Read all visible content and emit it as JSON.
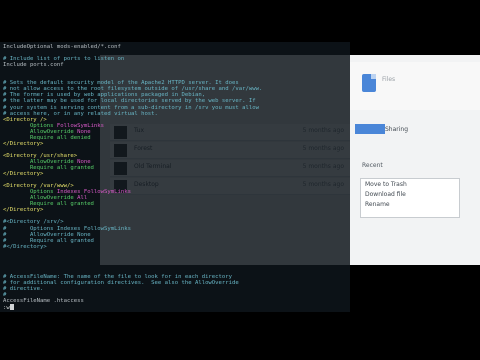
{
  "background_app": {
    "header_label": "Files",
    "rows": [
      {
        "name": "Tux",
        "date": "5 months ago"
      },
      {
        "name": "Forest",
        "date": "5 months ago"
      },
      {
        "name": "Old Terminal",
        "date": "5 months ago"
      },
      {
        "name": "Desktop",
        "date": "5 months ago"
      }
    ],
    "share_button": "",
    "share_link": "Sharing",
    "section_title": "Recent",
    "menu_items": [
      "Move to Trash",
      "Download file",
      "Rename"
    ]
  },
  "terminal": {
    "lines": [
      {
        "parts": [
          {
            "text": "IncludeOptional mods-enabled/*.conf",
            "class": ""
          }
        ]
      },
      {
        "parts": [
          {
            "text": "",
            "class": ""
          }
        ]
      },
      {
        "parts": [
          {
            "text": "# Include list of ports to listen on",
            "class": "c-comment"
          }
        ]
      },
      {
        "parts": [
          {
            "text": "Include ports.conf",
            "class": ""
          }
        ]
      },
      {
        "parts": [
          {
            "text": "",
            "class": ""
          }
        ]
      },
      {
        "parts": [
          {
            "text": "",
            "class": ""
          }
        ]
      },
      {
        "parts": [
          {
            "text": "# Sets the default security model of the Apache2 HTTPD server. It does",
            "class": "c-comment"
          }
        ]
      },
      {
        "parts": [
          {
            "text": "# not allow access to the root filesystem outside of /usr/share and /var/www.",
            "class": "c-comment"
          }
        ]
      },
      {
        "parts": [
          {
            "text": "# The former is used by web applications packaged in Debian,",
            "class": "c-comment"
          }
        ]
      },
      {
        "parts": [
          {
            "text": "# the latter may be used for local directories served by the web server. If",
            "class": "c-comment"
          }
        ]
      },
      {
        "parts": [
          {
            "text": "# your system is serving content from a sub-directory in /srv you must allow",
            "class": "c-comment"
          }
        ]
      },
      {
        "parts": [
          {
            "text": "# access here, or in any related virtual host.",
            "class": "c-comment"
          }
        ]
      },
      {
        "parts": [
          {
            "text": "<Directory />",
            "class": "c-tag"
          }
        ]
      },
      {
        "parts": [
          {
            "text": "        Options ",
            "class": "c-keyword"
          },
          {
            "text": "FollowSymLinks",
            "class": "c-value"
          }
        ]
      },
      {
        "parts": [
          {
            "text": "        AllowOverride ",
            "class": "c-keyword"
          },
          {
            "text": "None",
            "class": "c-value"
          }
        ]
      },
      {
        "parts": [
          {
            "text": "        Require all denied",
            "class": "c-keyword"
          }
        ]
      },
      {
        "parts": [
          {
            "text": "</Directory>",
            "class": "c-tag"
          }
        ]
      },
      {
        "parts": [
          {
            "text": "",
            "class": ""
          }
        ]
      },
      {
        "parts": [
          {
            "text": "<Directory /usr/share>",
            "class": "c-tag"
          }
        ]
      },
      {
        "parts": [
          {
            "text": "        AllowOverride ",
            "class": "c-keyword"
          },
          {
            "text": "None",
            "class": "c-value"
          }
        ]
      },
      {
        "parts": [
          {
            "text": "        Require all granted",
            "class": "c-keyword"
          }
        ]
      },
      {
        "parts": [
          {
            "text": "</Directory>",
            "class": "c-tag"
          }
        ]
      },
      {
        "parts": [
          {
            "text": "",
            "class": ""
          }
        ]
      },
      {
        "parts": [
          {
            "text": "<Directory /var/www/>",
            "class": "c-tag"
          }
        ]
      },
      {
        "parts": [
          {
            "text": "        Options ",
            "class": "c-keyword"
          },
          {
            "text": "Indexes FollowSymLinks",
            "class": "c-value"
          }
        ]
      },
      {
        "parts": [
          {
            "text": "        AllowOverride ",
            "class": "c-keyword"
          },
          {
            "text": "All",
            "class": "c-value"
          }
        ]
      },
      {
        "parts": [
          {
            "text": "        Require all granted",
            "class": "c-keyword"
          }
        ]
      },
      {
        "parts": [
          {
            "text": "</Directory>",
            "class": "c-tag"
          }
        ]
      },
      {
        "parts": [
          {
            "text": "",
            "class": ""
          }
        ]
      },
      {
        "parts": [
          {
            "text": "#<Directory /srv/>",
            "class": "c-comment"
          }
        ]
      },
      {
        "parts": [
          {
            "text": "#       Options Indexes FollowSymLinks",
            "class": "c-comment"
          }
        ]
      },
      {
        "parts": [
          {
            "text": "#       AllowOverride None",
            "class": "c-comment"
          }
        ]
      },
      {
        "parts": [
          {
            "text": "#       Require all granted",
            "class": "c-comment"
          }
        ]
      },
      {
        "parts": [
          {
            "text": "#</Directory>",
            "class": "c-comment"
          }
        ]
      },
      {
        "parts": [
          {
            "text": "",
            "class": ""
          }
        ]
      },
      {
        "parts": [
          {
            "text": "",
            "class": ""
          }
        ]
      },
      {
        "parts": [
          {
            "text": "",
            "class": ""
          }
        ]
      },
      {
        "parts": [
          {
            "text": "",
            "class": ""
          }
        ]
      },
      {
        "parts": [
          {
            "text": "# AccessFileName: The name of the file to look for in each directory",
            "class": "c-comment"
          }
        ]
      },
      {
        "parts": [
          {
            "text": "# for additional configuration directives.  See also the AllowOverride",
            "class": "c-comment"
          }
        ]
      },
      {
        "parts": [
          {
            "text": "# directive.",
            "class": "c-comment"
          }
        ]
      },
      {
        "parts": [
          {
            "text": "#",
            "class": "c-comment"
          }
        ]
      },
      {
        "parts": [
          {
            "text": "AccessFileName .htaccess",
            "class": ""
          }
        ]
      },
      {
        "parts": [
          {
            "text": ":w",
            "class": "c-prompt"
          }
        ],
        "cursor": true
      }
    ]
  }
}
